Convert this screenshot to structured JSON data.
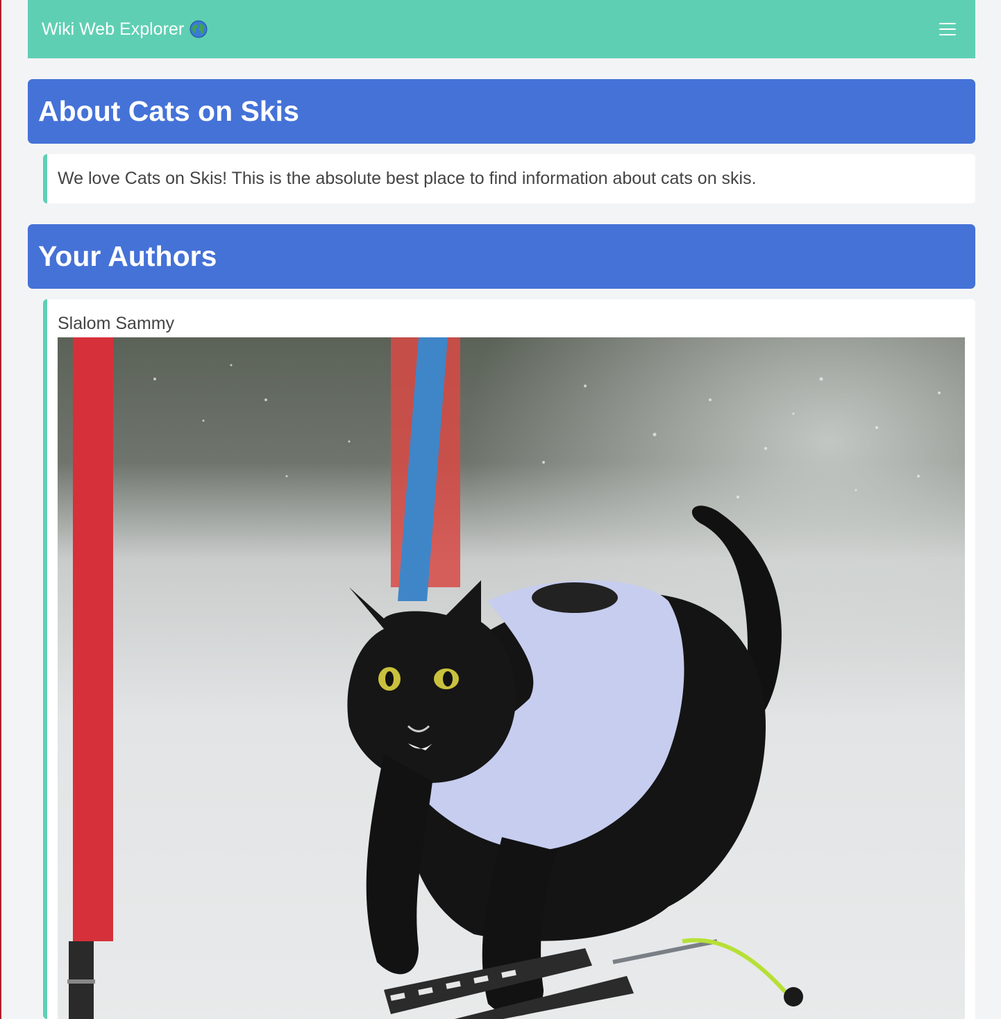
{
  "navbar": {
    "brand_text": "Wiki Web Explorer",
    "brand_icon": "globe-icon",
    "menu_icon": "hamburger-menu-icon",
    "background_color": "#5fcfb3"
  },
  "sections": {
    "about": {
      "heading": "About Cats on Skis",
      "text": "We love Cats on Skis! This is the absolute best place to find information about cats on skis."
    },
    "authors": {
      "heading": "Your Authors",
      "items": [
        {
          "name": "Slalom Sammy",
          "photo_icon": "cat-skiing-photo"
        }
      ]
    }
  },
  "colors": {
    "header_blue": "#4572d7",
    "accent_teal": "#5fcfb3",
    "page_bg": "#f3f4f6"
  }
}
